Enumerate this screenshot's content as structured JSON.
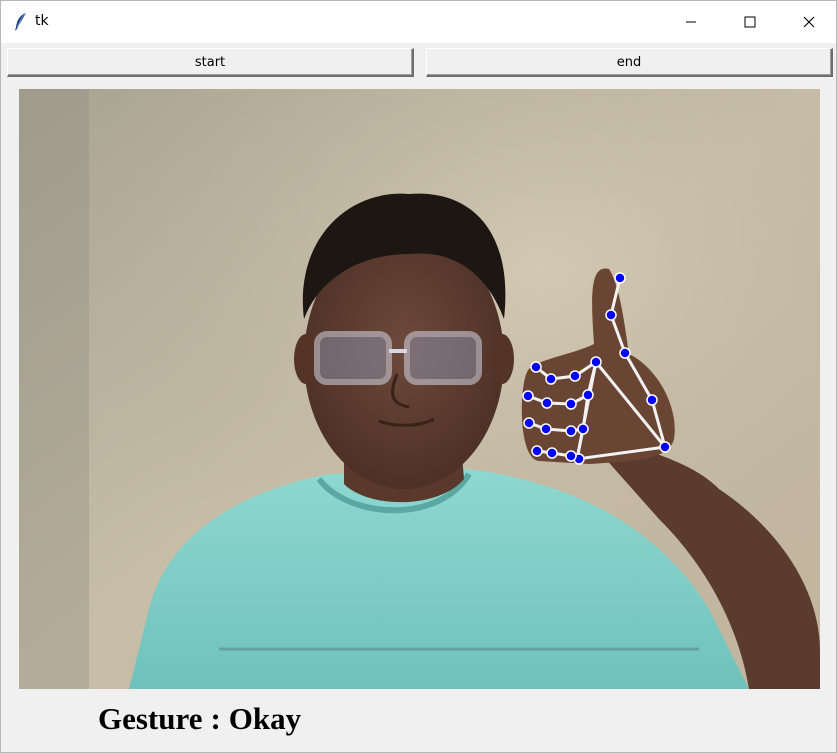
{
  "window": {
    "title": "tk",
    "icon": "feather-icon",
    "controls": [
      "minimize-icon",
      "maximize-icon",
      "close-icon"
    ]
  },
  "toolbar": {
    "start_label": "start",
    "end_label": "end"
  },
  "camera": {
    "description_icon": "webcam-feed",
    "landmark_color": "#0000ff",
    "connection_color": "#f2f2f2"
  },
  "gesture": {
    "prefix": "Gesture",
    "separator": ":",
    "value": "Okay"
  }
}
